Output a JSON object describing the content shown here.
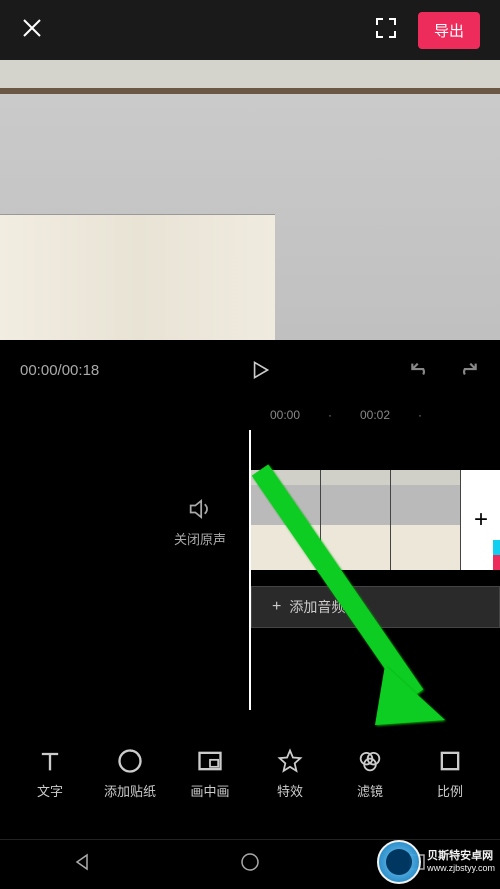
{
  "topbar": {
    "export_label": "导出"
  },
  "playbar": {
    "current_time": "00:00",
    "total_time": "00:18"
  },
  "ruler": {
    "marks": [
      "00:00",
      "·",
      "00:02",
      "·"
    ]
  },
  "mute": {
    "label": "关闭原声"
  },
  "tracks": {
    "audio_label": "添加音频",
    "add_clip_symbol": "+"
  },
  "toolbar": {
    "items": [
      {
        "name": "text-tool",
        "label": "文字"
      },
      {
        "name": "sticker-tool",
        "label": "添加贴纸"
      },
      {
        "name": "pip-tool",
        "label": "画中画"
      },
      {
        "name": "effects-tool",
        "label": "特效"
      },
      {
        "name": "filter-tool",
        "label": "滤镜"
      },
      {
        "name": "ratio-tool",
        "label": "比例"
      }
    ]
  },
  "watermark": {
    "brand": "贝斯特安卓网",
    "url": "www.zjbstyy.com"
  },
  "colors": {
    "accent": "#ee2c5b",
    "arrow": "#11cc22"
  }
}
